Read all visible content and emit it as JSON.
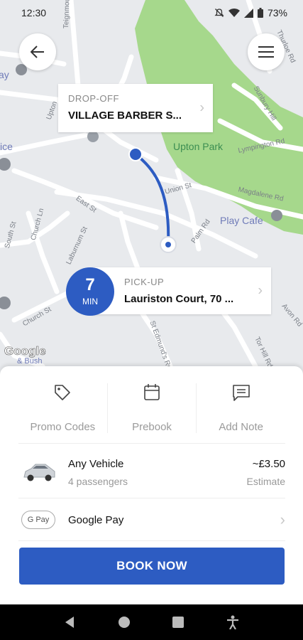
{
  "status_bar": {
    "time": "12:30",
    "battery": "73%"
  },
  "map": {
    "streets": [
      "Teignmouth Rd",
      "Upton",
      "Union St",
      "East St",
      "Laburnum St",
      "Church Ln",
      "Church St",
      "South St",
      "St Edmund's Rd",
      "Palm Rd",
      "Lympington Rd",
      "Magdalene Rd",
      "Tor Hill Rd",
      "Sunbury Hill",
      "Thurloe Rd",
      "Avon Rd"
    ],
    "park": "Upton Park",
    "poi": "Play Cafe",
    "edge_fragments": [
      "ay",
      "ice",
      "& Bush"
    ],
    "attribution": "Google"
  },
  "dropoff": {
    "label": "DROP-OFF",
    "value": "VILLAGE BARBER S..."
  },
  "pickup": {
    "label": "PICK-UP",
    "value": "Lauriston Court, 70 ..."
  },
  "eta": {
    "value": "7",
    "unit": "MIN"
  },
  "options": [
    {
      "label": "Promo Codes",
      "icon": "tag-icon"
    },
    {
      "label": "Prebook",
      "icon": "calendar-icon"
    },
    {
      "label": "Add Note",
      "icon": "note-icon"
    }
  ],
  "vehicle": {
    "name": "Any Vehicle",
    "capacity": "4 passengers",
    "price": "~£3.50",
    "price_note": "Estimate"
  },
  "payment": {
    "badge": "G Pay",
    "method": "Google Pay"
  },
  "book_button": "BOOK NOW",
  "colors": {
    "accent": "#2d5cc2",
    "park": "#a6d88c",
    "map_bg": "#e8eaed"
  }
}
